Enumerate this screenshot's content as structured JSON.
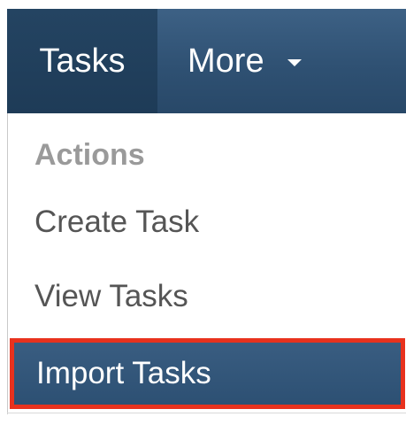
{
  "nav": {
    "active_tab": "Tasks",
    "more_label": "More"
  },
  "dropdown": {
    "header": "Actions",
    "items": [
      {
        "label": "Create Task"
      },
      {
        "label": "View Tasks"
      },
      {
        "label": "Import Tasks",
        "highlighted": true
      }
    ]
  },
  "colors": {
    "nav_bg": "#2f5173",
    "nav_active": "#1e3b57",
    "highlight_bg": "#2c4f72",
    "highlight_border": "#e8321e",
    "header_text": "#9a9a9a",
    "item_text": "#555555"
  },
  "icons": {
    "more_caret": "caret-down-icon"
  }
}
